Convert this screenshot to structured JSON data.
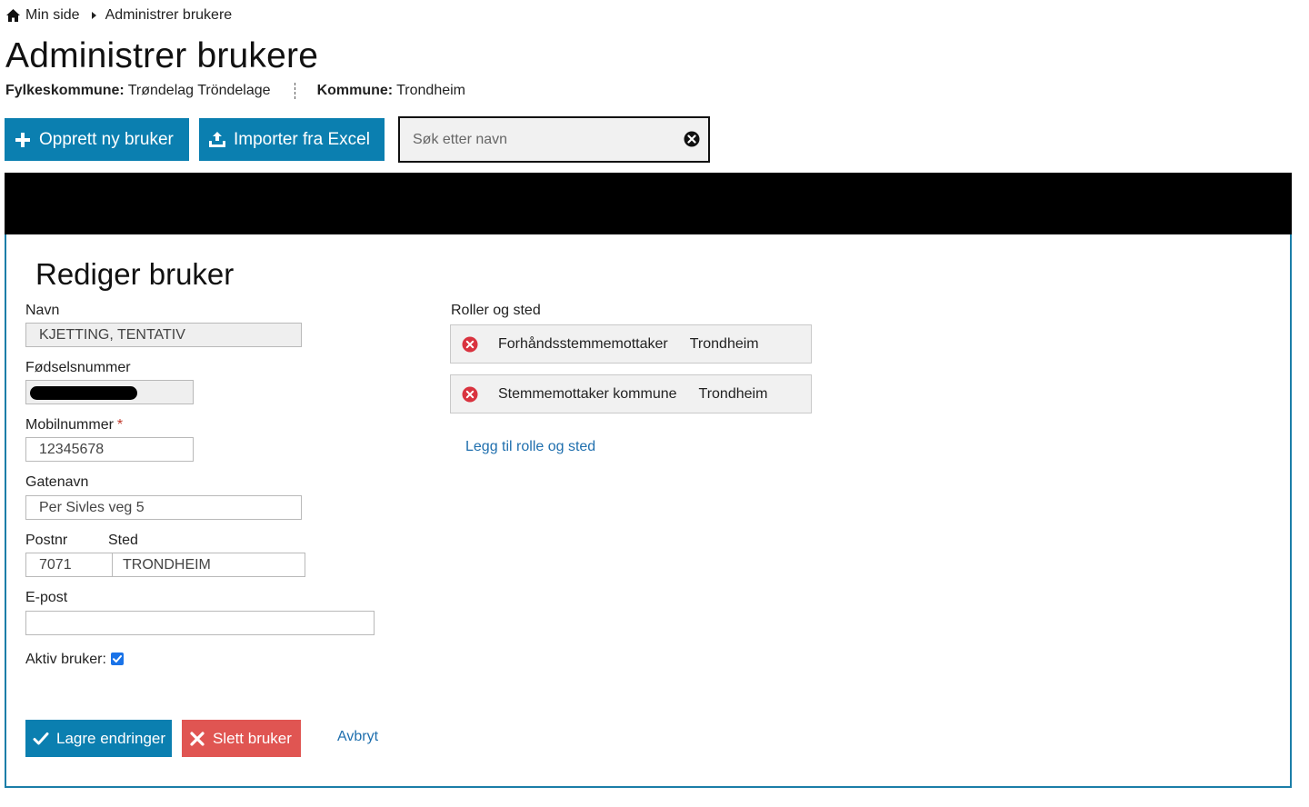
{
  "breadcrumb": {
    "home": "Min side",
    "current": "Administrer brukere"
  },
  "page_title": "Administrer brukere",
  "context": {
    "county_label": "Fylkeskommune:",
    "county_value": "Trøndelag Tröndelage",
    "municipality_label": "Kommune:",
    "municipality_value": "Trondheim"
  },
  "toolbar": {
    "new_user_label": "Opprett ny bruker",
    "import_label": "Importer fra Excel",
    "search_placeholder": "Søk etter navn"
  },
  "edit": {
    "title": "Rediger bruker",
    "name_label": "Navn",
    "name_value": "KJETTING, TENTATIV",
    "ssn_label": "Fødselsnummer",
    "mobile_label": "Mobilnummer",
    "mobile_required": "*",
    "mobile_value": "12345678",
    "street_label": "Gatenavn",
    "street_value": "Per Sivles veg 5",
    "postnr_label": "Postnr",
    "postnr_value": "7071",
    "place_label": "Sted",
    "place_value": "TRONDHEIM",
    "email_label": "E-post",
    "email_value": "",
    "active_label": "Aktiv bruker:",
    "active_checked": true
  },
  "roles": {
    "label": "Roller og sted",
    "items": [
      {
        "role": "Forhåndsstemmemottaker",
        "place": "Trondheim"
      },
      {
        "role": "Stemmemottaker kommune",
        "place": "Trondheim"
      }
    ],
    "add_link": "Legg til rolle og sted"
  },
  "actions": {
    "save_label": "Lagre endringer",
    "delete_label": "Slett bruker",
    "cancel_label": "Avbryt"
  },
  "colors": {
    "primary": "#0b7fb0",
    "danger": "#e05552",
    "remove_icon": "#d9333f",
    "link": "#1f6fae",
    "panel_border": "#1b7ea8"
  },
  "icons": {
    "home": "home-icon",
    "plus": "plus-icon",
    "import": "upload-icon",
    "clear": "close-circle-icon",
    "remove": "remove-circle-icon",
    "check": "check-icon",
    "x": "x-icon"
  }
}
